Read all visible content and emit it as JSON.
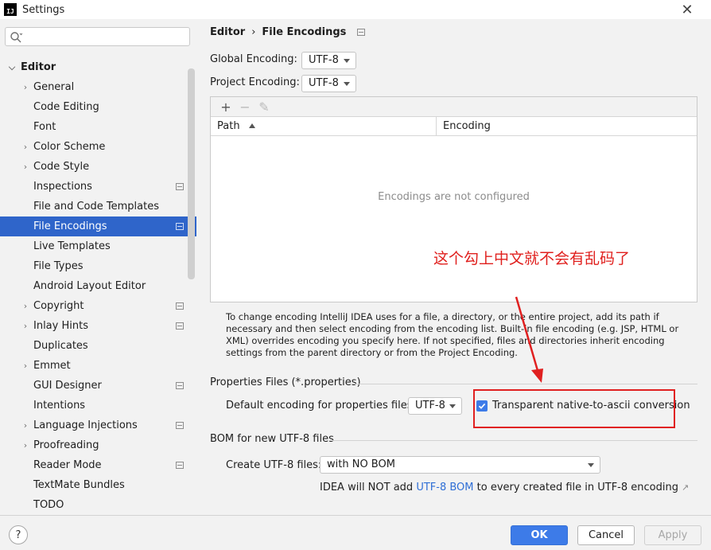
{
  "window": {
    "title": "Settings",
    "app_icon_text": "IJ"
  },
  "sidebar": {
    "search_placeholder": "",
    "header": "Editor",
    "items": [
      {
        "label": "General",
        "expandable": true,
        "project_icon": false
      },
      {
        "label": "Code Editing",
        "expandable": false,
        "project_icon": false
      },
      {
        "label": "Font",
        "expandable": false,
        "project_icon": false
      },
      {
        "label": "Color Scheme",
        "expandable": true,
        "project_icon": false
      },
      {
        "label": "Code Style",
        "expandable": true,
        "project_icon": false
      },
      {
        "label": "Inspections",
        "expandable": false,
        "project_icon": true
      },
      {
        "label": "File and Code Templates",
        "expandable": false,
        "project_icon": false
      },
      {
        "label": "File Encodings",
        "expandable": false,
        "project_icon": true,
        "selected": true
      },
      {
        "label": "Live Templates",
        "expandable": false,
        "project_icon": false
      },
      {
        "label": "File Types",
        "expandable": false,
        "project_icon": false
      },
      {
        "label": "Android Layout Editor",
        "expandable": false,
        "project_icon": false
      },
      {
        "label": "Copyright",
        "expandable": true,
        "project_icon": true
      },
      {
        "label": "Inlay Hints",
        "expandable": true,
        "project_icon": true
      },
      {
        "label": "Duplicates",
        "expandable": false,
        "project_icon": false
      },
      {
        "label": "Emmet",
        "expandable": true,
        "project_icon": false
      },
      {
        "label": "GUI Designer",
        "expandable": false,
        "project_icon": true
      },
      {
        "label": "Intentions",
        "expandable": false,
        "project_icon": false
      },
      {
        "label": "Language Injections",
        "expandable": true,
        "project_icon": true
      },
      {
        "label": "Proofreading",
        "expandable": true,
        "project_icon": false
      },
      {
        "label": "Reader Mode",
        "expandable": false,
        "project_icon": true
      },
      {
        "label": "TextMate Bundles",
        "expandable": false,
        "project_icon": false
      },
      {
        "label": "TODO",
        "expandable": false,
        "project_icon": false
      }
    ]
  },
  "breadcrumb": {
    "parent": "Editor",
    "separator": "›",
    "current": "File Encodings"
  },
  "encodings": {
    "global_label": "Global Encoding:",
    "global_value": "UTF-8",
    "project_label": "Project Encoding:",
    "project_value": "UTF-8"
  },
  "table": {
    "col_path": "Path",
    "col_encoding": "Encoding",
    "empty_text": "Encodings are not configured",
    "toolbar": {
      "add": "+",
      "remove": "−",
      "edit": "✎"
    }
  },
  "help_text": "To change encoding IntelliJ IDEA uses for a file, a directory, or the entire project, add its path if necessary and then select encoding from the encoding list. Built-in file encoding (e.g. JSP, HTML or XML) overrides encoding you specify here. If not specified, files and directories inherit encoding settings from the parent directory or from the Project Encoding.",
  "properties": {
    "section_title": "Properties Files (*.properties)",
    "default_label": "Default encoding for properties files:",
    "default_value": "UTF-8",
    "transparent_label": "Transparent native-to-ascii conversion",
    "transparent_checked": true
  },
  "bom": {
    "section_title": "BOM for new UTF-8 files",
    "create_label": "Create UTF-8 files:",
    "create_value": "with NO BOM",
    "note_prefix": "IDEA will NOT add ",
    "note_link": "UTF-8 BOM",
    "note_suffix": " to every created file in UTF-8 encoding",
    "note_arrow": "↗"
  },
  "annotation": {
    "text": "这个勾上中文就不会有乱码了",
    "color": "#e0201e"
  },
  "buttons": {
    "help": "?",
    "ok": "OK",
    "cancel": "Cancel",
    "apply": "Apply"
  },
  "colors": {
    "accent": "#3d7be8",
    "selection": "#2f65ca",
    "link": "#2f6fd6",
    "annotation_red": "#e02020"
  }
}
